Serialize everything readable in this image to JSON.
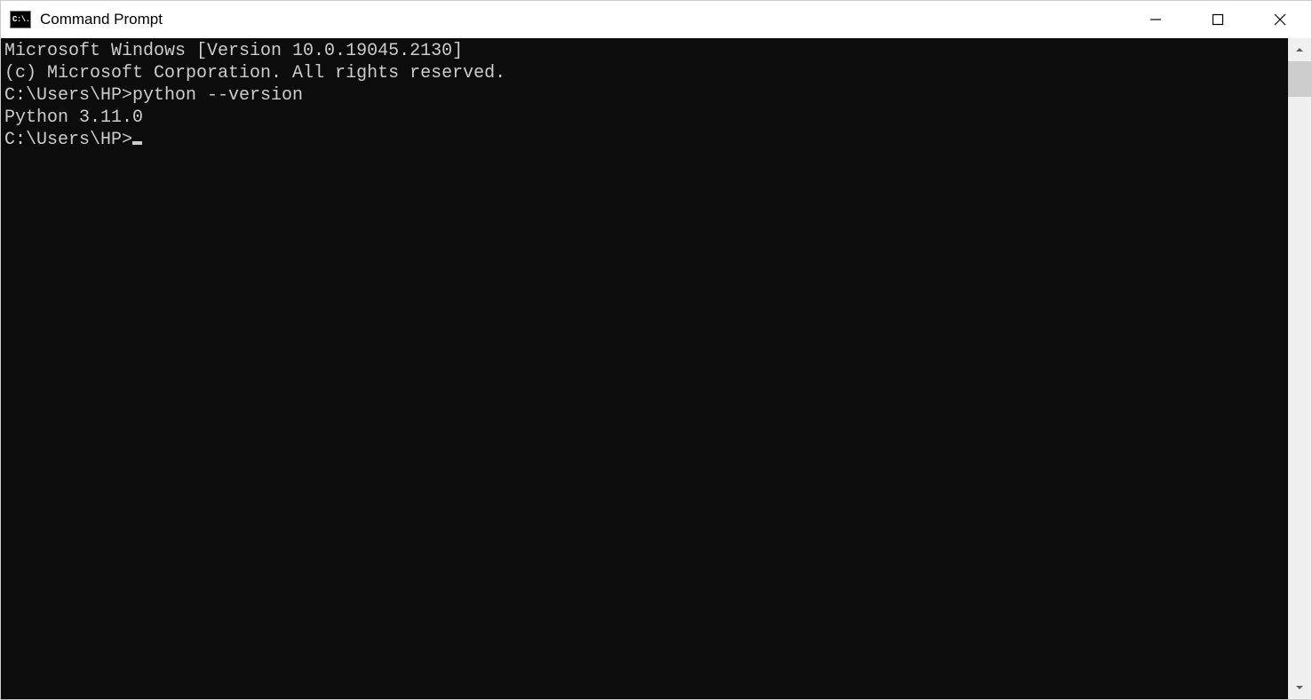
{
  "window": {
    "icon_text": "C:\\.",
    "title": "Command Prompt"
  },
  "terminal": {
    "lines": {
      "l0": "Microsoft Windows [Version 10.0.19045.2130]",
      "l1": "(c) Microsoft Corporation. All rights reserved.",
      "l2": "",
      "l3_prompt": "C:\\Users\\HP>",
      "l3_cmd": "python --version",
      "l4": "Python 3.11.0",
      "l5": "",
      "l6_prompt": "C:\\Users\\HP>"
    }
  }
}
